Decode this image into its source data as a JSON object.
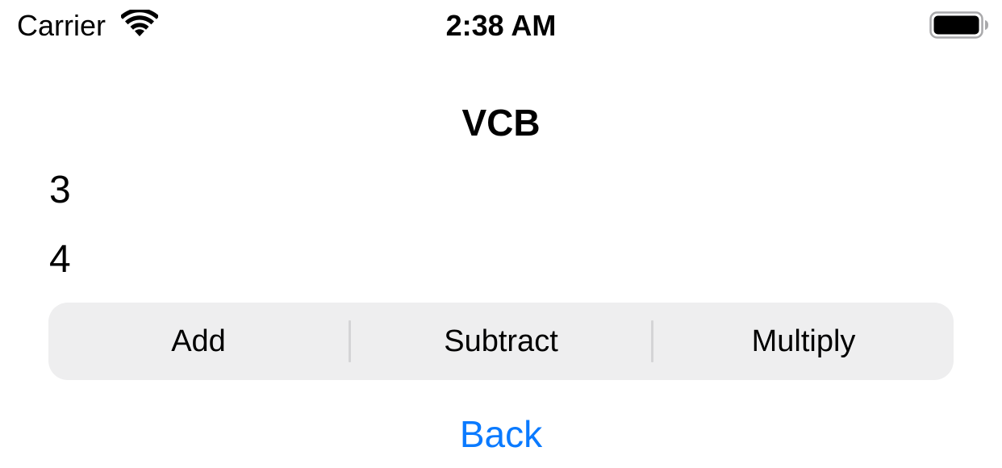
{
  "status_bar": {
    "carrier": "Carrier",
    "time": "2:38 AM",
    "wifi_icon": "wifi-icon",
    "battery_icon": "battery-full-icon"
  },
  "nav": {
    "title": "VCB"
  },
  "values": {
    "first": "3",
    "second": "4"
  },
  "segmented_control": {
    "segments": [
      {
        "label": "Add"
      },
      {
        "label": "Subtract"
      },
      {
        "label": "Multiply"
      }
    ]
  },
  "back_label": "Back",
  "colors": {
    "accent": "#0a7aff",
    "segment_bg": "#eeeeef",
    "divider": "#d4d4d6"
  }
}
